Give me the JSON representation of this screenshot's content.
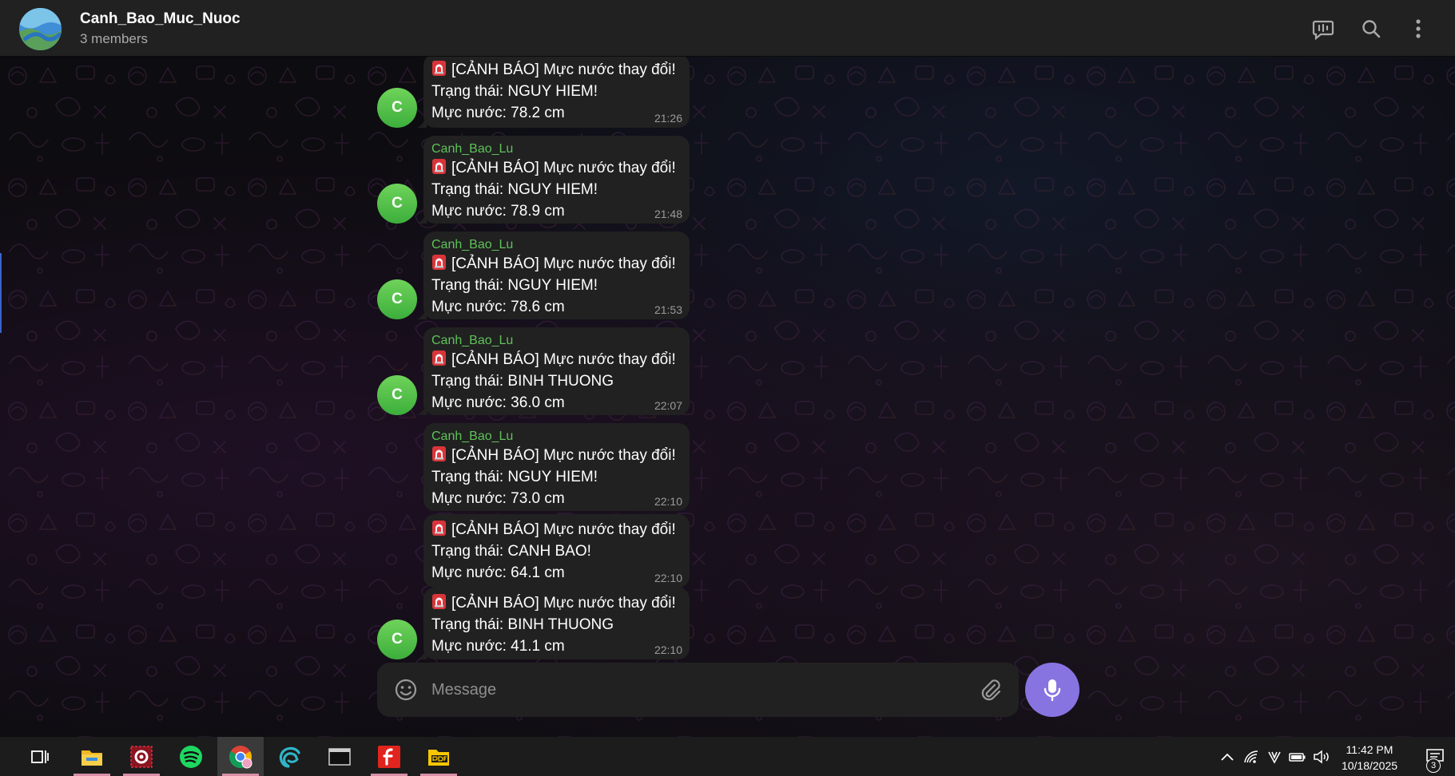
{
  "header": {
    "title": "Canh_Bao_Muc_Nuoc",
    "subtitle": "3 members"
  },
  "messages": [
    {
      "sender": "",
      "line1": "[CẢNH BÁO] Mực nước thay đổi!",
      "line2": "Trạng thái: NGUY HIEM!",
      "line3": "Mực nước: 78.2 cm",
      "time": "21:26",
      "avatar": "C"
    },
    {
      "sender": "Canh_Bao_Lu",
      "line1": "[CẢNH BÁO] Mực nước thay đổi!",
      "line2": "Trạng thái: NGUY HIEM!",
      "line3": "Mực nước: 78.9 cm",
      "time": "21:48",
      "avatar": "C"
    },
    {
      "sender": "Canh_Bao_Lu",
      "line1": "[CẢNH BÁO] Mực nước thay đổi!",
      "line2": "Trạng thái: NGUY HIEM!",
      "line3": "Mực nước: 78.6 cm",
      "time": "21:53",
      "avatar": "C"
    },
    {
      "sender": "Canh_Bao_Lu",
      "line1": "[CẢNH BÁO] Mực nước thay đổi!",
      "line2": "Trạng thái: BINH THUONG",
      "line3": "Mực nước: 36.0 cm",
      "time": "22:07",
      "avatar": "C"
    },
    {
      "sender": "Canh_Bao_Lu",
      "line1": "[CẢNH BÁO] Mực nước thay đổi!",
      "line2": "Trạng thái: NGUY HIEM!",
      "line3": "Mực nước: 73.0 cm",
      "time": "22:10",
      "avatar": ""
    },
    {
      "sender": "",
      "line1": "[CẢNH BÁO] Mực nước thay đổi!",
      "line2": "Trạng thái: CANH BAO!",
      "line3": "Mực nước: 64.1 cm",
      "time": "22:10",
      "avatar": ""
    },
    {
      "sender": "",
      "line1": "[CẢNH BÁO] Mực nước thay đổi!",
      "line2": "Trạng thái: BINH THUONG",
      "line3": "Mực nước: 41.1 cm",
      "time": "22:10",
      "avatar": "C"
    }
  ],
  "composer": {
    "placeholder": "Message"
  },
  "taskbar": {
    "apps": [
      "file-explorer",
      "settings-tool",
      "spotify",
      "chrome",
      "edge-dev",
      "terminal",
      "foxit-reader",
      "pdf-tool"
    ],
    "clock_time": "11:42 PM",
    "clock_date": "10/18/2025",
    "notification_count": "3"
  },
  "colors": {
    "accent": "#8774e1",
    "sender_green": "#5fc25a",
    "bubble": "#212121",
    "header": "#212121"
  }
}
